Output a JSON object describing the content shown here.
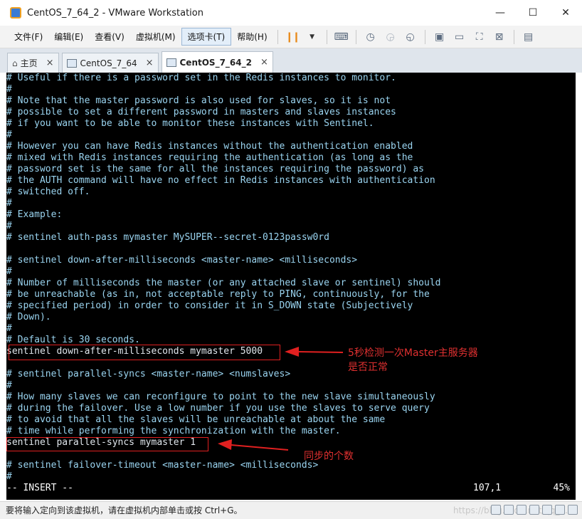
{
  "window": {
    "title": "CentOS_7_64_2 - VMware Workstation",
    "controls": {
      "minimize": "—",
      "maximize": "☐",
      "close": "✕"
    }
  },
  "menu": {
    "items": [
      "文件(F)",
      "编辑(E)",
      "查看(V)",
      "虚拟机(M)",
      "选项卡(T)",
      "帮助(H)"
    ]
  },
  "tabs": [
    {
      "label": "主页",
      "close": "×"
    },
    {
      "label": "CentOS_7_64",
      "close": "×"
    },
    {
      "label": "CentOS_7_64_2",
      "close": "×"
    }
  ],
  "terminal": {
    "lines": [
      "# Useful if there is a password set in the Redis instances to monitor.",
      "#",
      "# Note that the master password is also used for slaves, so it is not",
      "# possible to set a different password in masters and slaves instances",
      "# if you want to be able to monitor these instances with Sentinel.",
      "#",
      "# However you can have Redis instances without the authentication enabled",
      "# mixed with Redis instances requiring the authentication (as long as the",
      "# password set is the same for all the instances requiring the password) as",
      "# the AUTH command will have no effect in Redis instances with authentication",
      "# switched off.",
      "#",
      "# Example:",
      "#",
      "# sentinel auth-pass mymaster MySUPER--secret-0123passw0rd",
      "",
      "# sentinel down-after-milliseconds <master-name> <milliseconds>",
      "#",
      "# Number of milliseconds the master (or any attached slave or sentinel) should",
      "# be unreachable (as in, not acceptable reply to PING, continuously, for the",
      "# specified period) in order to consider it in S_DOWN state (Subjectively",
      "# Down).",
      "#",
      "# Default is 30 seconds.",
      "sentinel down-after-milliseconds mymaster 5000",
      "",
      "# sentinel parallel-syncs <master-name> <numslaves>",
      "#",
      "# How many slaves we can reconfigure to point to the new slave simultaneously",
      "# during the failover. Use a low number if you use the slaves to serve query",
      "# to avoid that all the slaves will be unreachable at about the same",
      "# time while performing the synchronization with the master.",
      "sentinel parallel-syncs mymaster 1",
      "",
      "# sentinel failover-timeout <master-name> <milliseconds>",
      "#"
    ],
    "mode": "-- INSERT --",
    "position": "107,1",
    "percent": "45%"
  },
  "annotations": {
    "note1_line1": "5秒检测一次Master主服务器",
    "note1_line2": "是否正常",
    "note2": "同步的个数",
    "color": "#e02020"
  },
  "statusbar": {
    "hint": "要将输入定向到该虚拟机，请在虚拟机内部单击或按 Ctrl+G。",
    "watermark": "https://blog.csdn.net/qq_..."
  }
}
